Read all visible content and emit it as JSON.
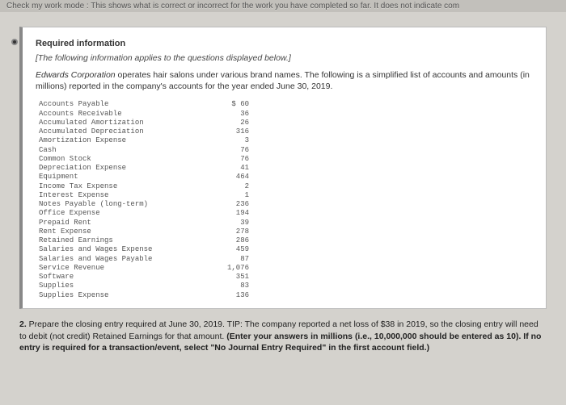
{
  "topbar": {
    "text": "Check my work mode : This shows what is correct or incorrect for the work you have completed so far. It does not indicate com"
  },
  "panel": {
    "required_title": "Required information",
    "bracket_note": "[The following information applies to the questions displayed below.]",
    "company": "Edwards Corporation",
    "scenario_rest": " operates hair salons under various brand names. The following is a simplified list of accounts and amounts (in millions) reported in the company's accounts for the year ended June 30, 2019.",
    "currency": "$",
    "accounts": [
      {
        "name": "Accounts Payable",
        "value": "60"
      },
      {
        "name": "Accounts Receivable",
        "value": "36"
      },
      {
        "name": "Accumulated Amortization",
        "value": "26"
      },
      {
        "name": "Accumulated Depreciation",
        "value": "316"
      },
      {
        "name": "Amortization Expense",
        "value": "3"
      },
      {
        "name": "Cash",
        "value": "76"
      },
      {
        "name": "Common Stock",
        "value": "76"
      },
      {
        "name": "Depreciation Expense",
        "value": "41"
      },
      {
        "name": "Equipment",
        "value": "464"
      },
      {
        "name": "Income Tax Expense",
        "value": "2"
      },
      {
        "name": "Interest Expense",
        "value": "1"
      },
      {
        "name": "Notes Payable (long-term)",
        "value": "236"
      },
      {
        "name": "Office Expense",
        "value": "194"
      },
      {
        "name": "Prepaid Rent",
        "value": "39"
      },
      {
        "name": "Rent Expense",
        "value": "278"
      },
      {
        "name": "Retained Earnings",
        "value": "286"
      },
      {
        "name": "Salaries and Wages Expense",
        "value": "459"
      },
      {
        "name": "Salaries and Wages Payable",
        "value": "87"
      },
      {
        "name": "Service Revenue",
        "value": "1,076"
      },
      {
        "name": "Software",
        "value": "351"
      },
      {
        "name": "Supplies",
        "value": "83"
      },
      {
        "name": "Supplies Expense",
        "value": "136"
      }
    ]
  },
  "question": {
    "number": "2.",
    "body": " Prepare the closing entry required at June 30, 2019. TIP: The company reported a net loss of $38 in 2019, so the closing entry will need to debit (not credit) Retained Earnings for that amount. ",
    "bold_tail": "(Enter your answers in millions (i.e., 10,000,000 should be entered as 10). If no entry is required for a transaction/event, select \"No Journal Entry Required\" in the first account field.)"
  }
}
